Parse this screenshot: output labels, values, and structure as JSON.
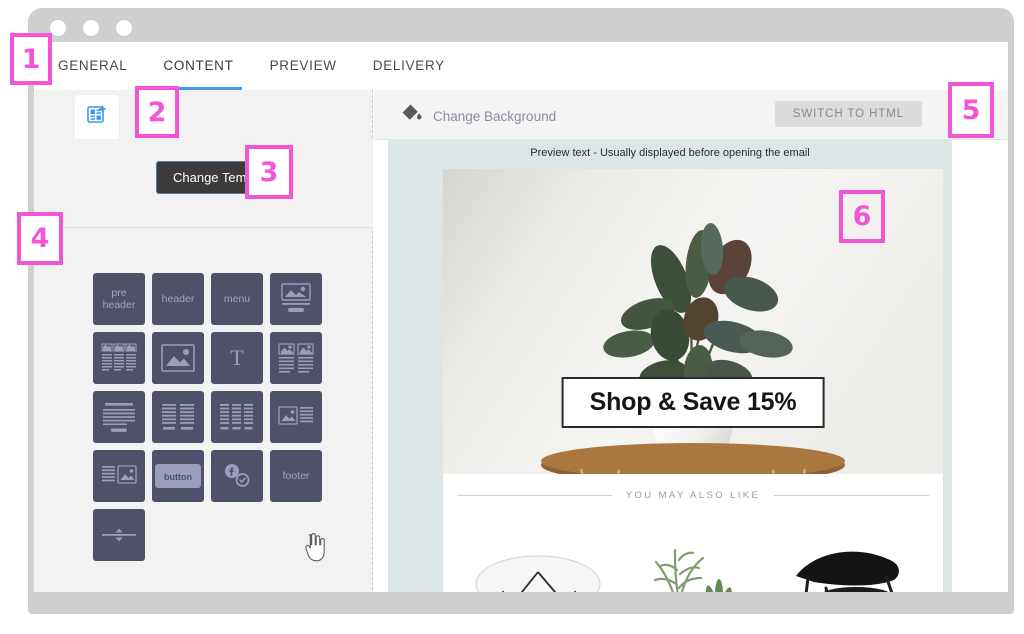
{
  "window": {
    "dots": [
      "window-dot-1",
      "window-dot-2",
      "window-dot-3"
    ]
  },
  "topnav": {
    "tabs": [
      {
        "label": "GENERAL",
        "active": false
      },
      {
        "label": "CONTENT",
        "active": true
      },
      {
        "label": "PREVIEW",
        "active": false
      },
      {
        "label": "DELIVERY",
        "active": false
      }
    ]
  },
  "left_panel": {
    "tabs": [
      {
        "icon": "content-blocks-icon",
        "active": true
      },
      {
        "icon": "code-braces-icon",
        "active": false
      }
    ],
    "change_template_label": "Change Template",
    "blocks": [
      {
        "name": "pre-header-block",
        "label": "pre\nheader",
        "type": "text"
      },
      {
        "name": "header-block",
        "label": "header",
        "type": "text"
      },
      {
        "name": "menu-block",
        "label": "menu",
        "type": "text"
      },
      {
        "name": "image-with-button-block",
        "label": "",
        "type": "image-bar-button"
      },
      {
        "name": "three-column-image-text-block",
        "label": "",
        "type": "three-col-img-text"
      },
      {
        "name": "image-block",
        "label": "",
        "type": "big-image"
      },
      {
        "name": "text-block",
        "label": "T",
        "type": "letter"
      },
      {
        "name": "two-column-image-text-block",
        "label": "",
        "type": "two-col-img-text"
      },
      {
        "name": "title-paragraph-button-block",
        "label": "",
        "type": "title-para-button"
      },
      {
        "name": "two-column-text-block",
        "label": "",
        "type": "two-col-text"
      },
      {
        "name": "three-column-text-block",
        "label": "",
        "type": "three-col-text"
      },
      {
        "name": "image-text-right-block",
        "label": "",
        "type": "img-left-text-right"
      },
      {
        "name": "text-left-image-right-block",
        "label": "",
        "type": "text-left-img-right"
      },
      {
        "name": "button-block",
        "label": "button",
        "type": "button"
      },
      {
        "name": "social-icons-block",
        "label": "",
        "type": "social"
      },
      {
        "name": "footer-block",
        "label": "footer",
        "type": "text"
      },
      {
        "name": "divider-block",
        "label": "",
        "type": "divider"
      }
    ],
    "cursor": "hand-pointer-cursor"
  },
  "preview": {
    "change_background_label": "Change Background",
    "change_background_icon": "paint-bucket-icon",
    "switch_to_html_label": "SWITCH TO HTML",
    "preview_text": "Preview text - Usually displayed before opening the email",
    "cta_text": "Shop & Save 15%",
    "also_like_text": "YOU MAY ALSO LIKE",
    "products": [
      {
        "name": "oval-coffee-table"
      },
      {
        "name": "potted-plants"
      },
      {
        "name": "black-lounge-chair"
      }
    ]
  },
  "callouts": [
    {
      "number": "1"
    },
    {
      "number": "2"
    },
    {
      "number": "3"
    },
    {
      "number": "4"
    },
    {
      "number": "5"
    },
    {
      "number": "6"
    }
  ],
  "colors": {
    "accent_magenta": "#f355d8",
    "tab_underline_blue": "#3d9ae8",
    "block_tile": "#4e5169",
    "panel_bg": "#f2f2f2",
    "preview_bg": "#dde6e6",
    "chrome_gray": "#cfcfcf"
  }
}
